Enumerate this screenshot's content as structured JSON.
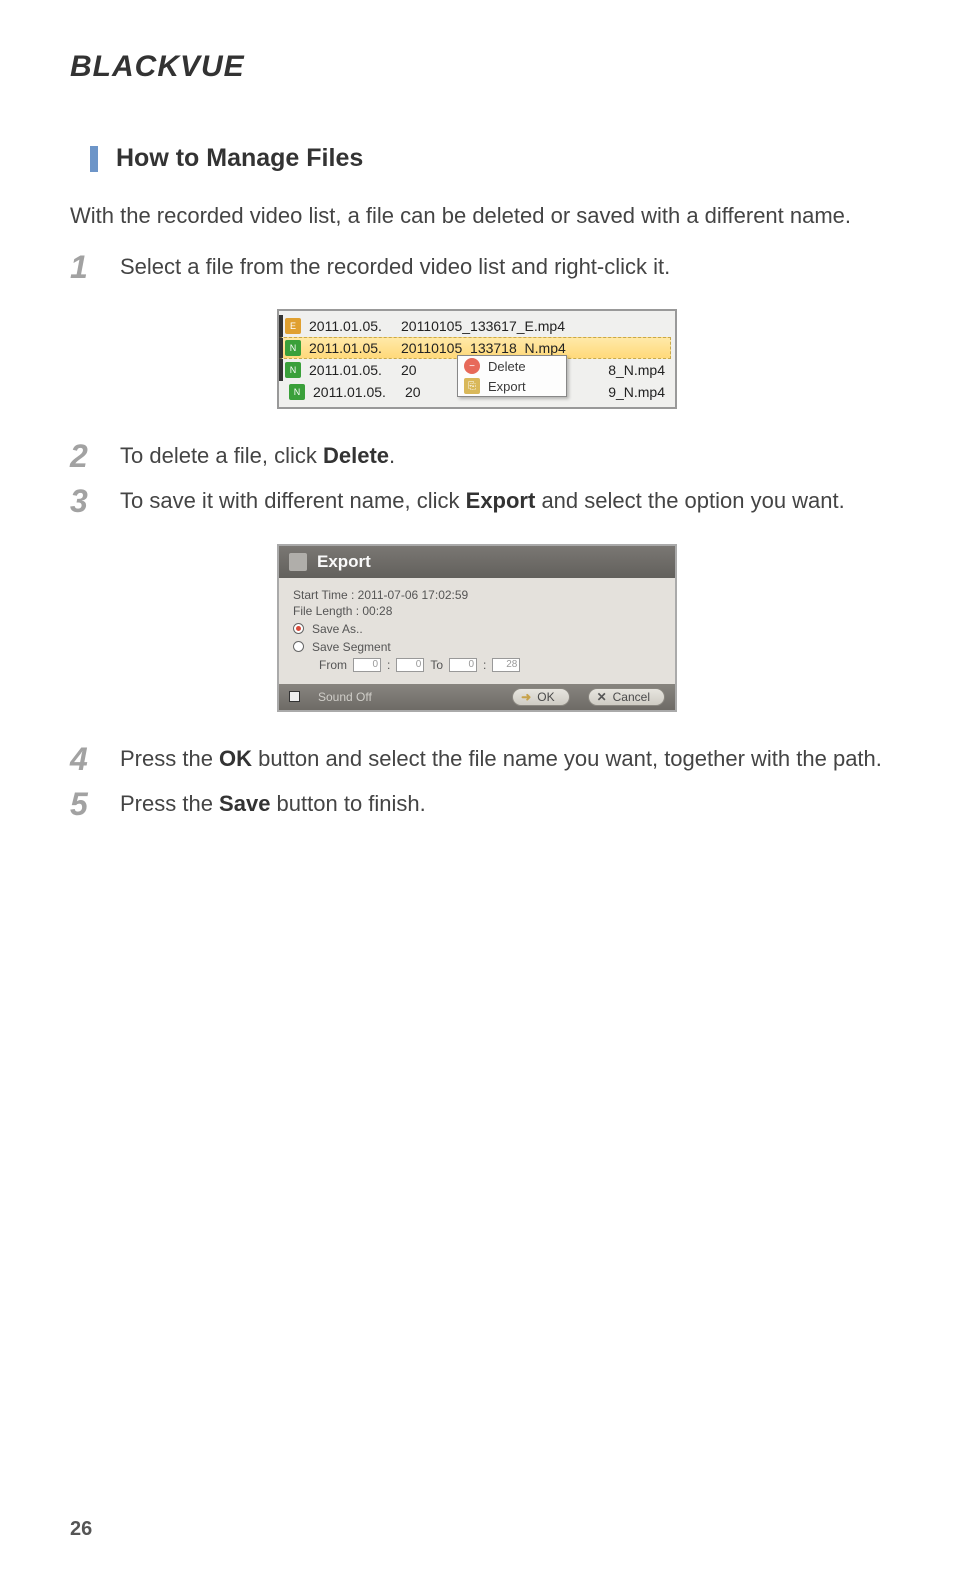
{
  "brand": "BLACKVUE",
  "section_title": "How to Manage Files",
  "intro": "With the recorded video list, a file can be deleted or saved with a different name.",
  "steps": {
    "s1": {
      "num": "1",
      "text": "Select a file from the recorded video list and right-click it."
    },
    "s2": {
      "num": "2",
      "prefix": "To delete a file, click ",
      "bold": "Delete",
      "suffix": "."
    },
    "s3": {
      "num": "3",
      "prefix": "To save it with different name, click ",
      "bold": "Export",
      "suffix": " and select the option you want."
    },
    "s4": {
      "num": "4",
      "prefix": "Press the ",
      "bold": "OK",
      "suffix": " button and select the file name you want, together with the path."
    },
    "s5": {
      "num": "5",
      "prefix": "Press the ",
      "bold": "Save",
      "suffix": " button to finish."
    }
  },
  "file_list": {
    "rows": [
      {
        "date": "2011.01.05.",
        "name": "20110105_133617_E.mp4",
        "type": "E"
      },
      {
        "date": "2011.01.05.",
        "name": "20110105_133718_N.mp4",
        "type": "N"
      },
      {
        "date": "2011.01.05.",
        "name_left": "20",
        "name_right": "8_N.mp4",
        "type": "N"
      },
      {
        "date": "2011.01.05.",
        "name_left": "20",
        "name_right": "9_N.mp4",
        "type": "N"
      }
    ],
    "context_menu": {
      "delete": "Delete",
      "export": "Export"
    }
  },
  "export_dialog": {
    "title": "Export",
    "start_time": "Start Time : 2011-07-06 17:02:59",
    "file_length": "File Length : 00:28",
    "save_as": "Save As..",
    "save_segment": "Save Segment",
    "from_label": "From",
    "to_label": "To",
    "from_m": "0",
    "from_s": "0",
    "to_m": "0",
    "to_s": "28",
    "sound_off": "Sound Off",
    "ok": "OK",
    "cancel": "Cancel"
  },
  "page_number": "26"
}
